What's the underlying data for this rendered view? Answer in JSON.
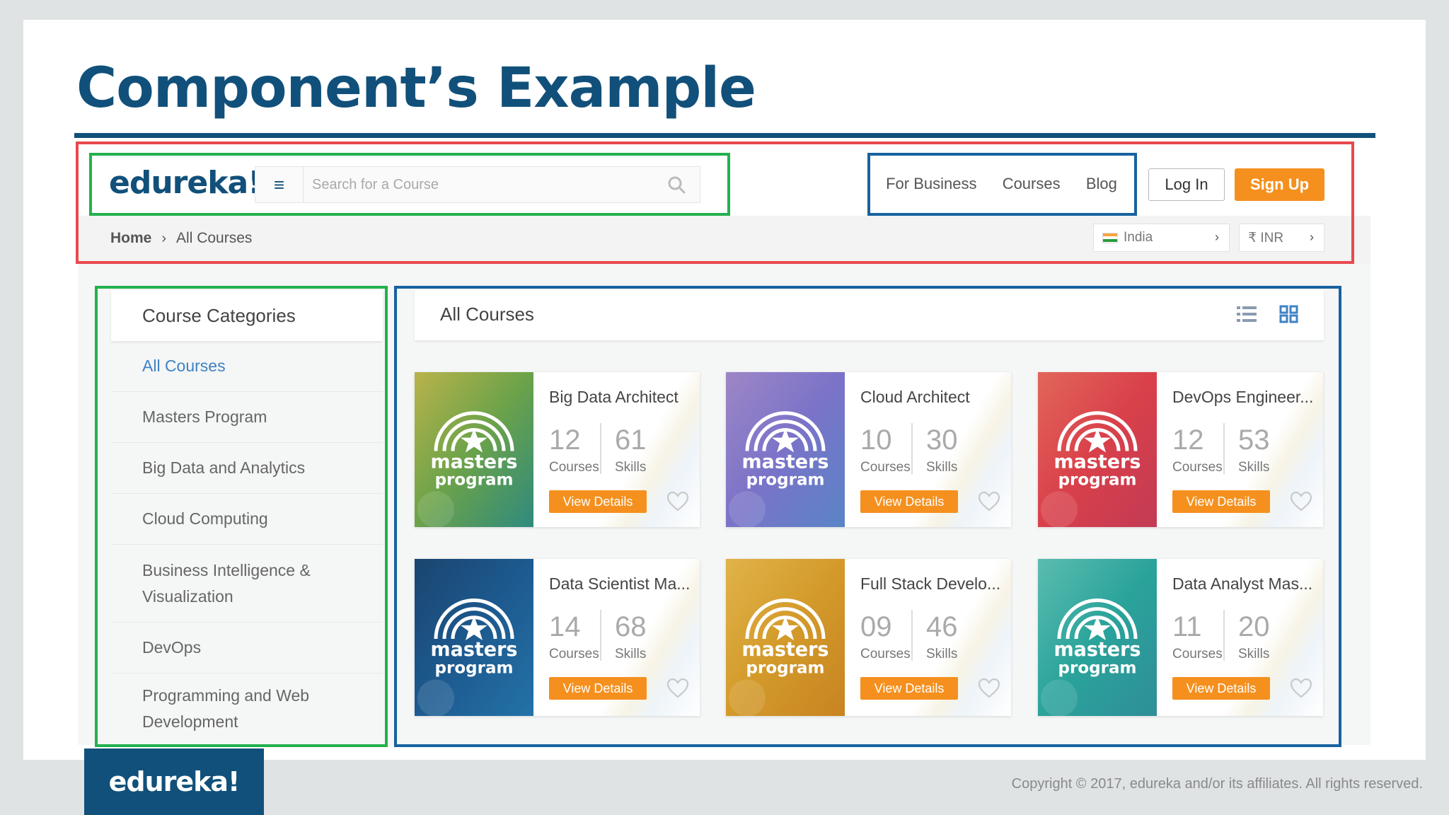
{
  "slide": {
    "title": "Component’s Example",
    "footer_logo": "edureka!",
    "copyright": "Copyright © 2017, edureka and/or its affiliates. All rights reserved."
  },
  "header": {
    "logo": "edureka!",
    "search_placeholder": "Search for a Course",
    "nav": [
      "For Business",
      "Courses",
      "Blog"
    ],
    "login_label": "Log In",
    "signup_label": "Sign Up"
  },
  "breadcrumb": {
    "home": "Home",
    "current": "All Courses"
  },
  "region": {
    "country": "India",
    "currency": "₹ INR"
  },
  "sidebar": {
    "title": "Course Categories",
    "items": [
      {
        "label": "All Courses",
        "active": true
      },
      {
        "label": "Masters Program",
        "active": false
      },
      {
        "label": "Big Data and Analytics",
        "active": false
      },
      {
        "label": "Cloud Computing",
        "active": false
      },
      {
        "label": "Business Intelligence & Visualization",
        "active": false
      },
      {
        "label": "DevOps",
        "active": false
      },
      {
        "label": "Programming and Web Development",
        "active": false
      }
    ]
  },
  "main": {
    "title": "All Courses",
    "view_icons": [
      "list-view-icon",
      "grid-view-icon"
    ]
  },
  "cards": [
    {
      "title": "Big Data Architect",
      "courses": "12",
      "skills": "61",
      "courses_label": "Courses",
      "skills_label": "Skills",
      "button": "View Details",
      "thumb_text_1": "masters",
      "thumb_text_2": "program",
      "colors": [
        "#6aa24a",
        "#2f8a7e",
        "#b9b34b"
      ]
    },
    {
      "title": "Cloud Architect",
      "courses": "10",
      "skills": "30",
      "courses_label": "Courses",
      "skills_label": "Skills",
      "button": "View Details",
      "thumb_text_1": "masters",
      "thumb_text_2": "program",
      "colors": [
        "#7a73c8",
        "#5a84c6",
        "#9e86c6"
      ]
    },
    {
      "title": "DevOps Engineer...",
      "courses": "12",
      "skills": "53",
      "courses_label": "Courses",
      "skills_label": "Skills",
      "button": "View Details",
      "thumb_text_1": "masters",
      "thumb_text_2": "program",
      "colors": [
        "#d9404a",
        "#c23b55",
        "#e2665a"
      ]
    },
    {
      "title": "Data Scientist Ma...",
      "courses": "14",
      "skills": "68",
      "courses_label": "Courses",
      "skills_label": "Skills",
      "button": "View Details",
      "thumb_text_1": "masters",
      "thumb_text_2": "program",
      "colors": [
        "#1d5a8f",
        "#2372a8",
        "#1a4570"
      ]
    },
    {
      "title": "Full Stack Develo...",
      "courses": "09",
      "skills": "46",
      "courses_label": "Courses",
      "skills_label": "Skills",
      "button": "View Details",
      "thumb_text_1": "masters",
      "thumb_text_2": "program",
      "colors": [
        "#d39a2a",
        "#c88422",
        "#e0b34a"
      ]
    },
    {
      "title": "Data Analyst Mas...",
      "courses": "11",
      "skills": "20",
      "courses_label": "Courses",
      "skills_label": "Skills",
      "button": "View Details",
      "thumb_text_1": "masters",
      "thumb_text_2": "program",
      "colors": [
        "#2aa39a",
        "#2f8e99",
        "#5bbcb0"
      ]
    }
  ],
  "colors": {
    "brand": "#11507a",
    "accent": "#f5901e",
    "annotation_red": "#e8494f",
    "annotation_green": "#23b14d",
    "annotation_blue": "#1762a0"
  }
}
